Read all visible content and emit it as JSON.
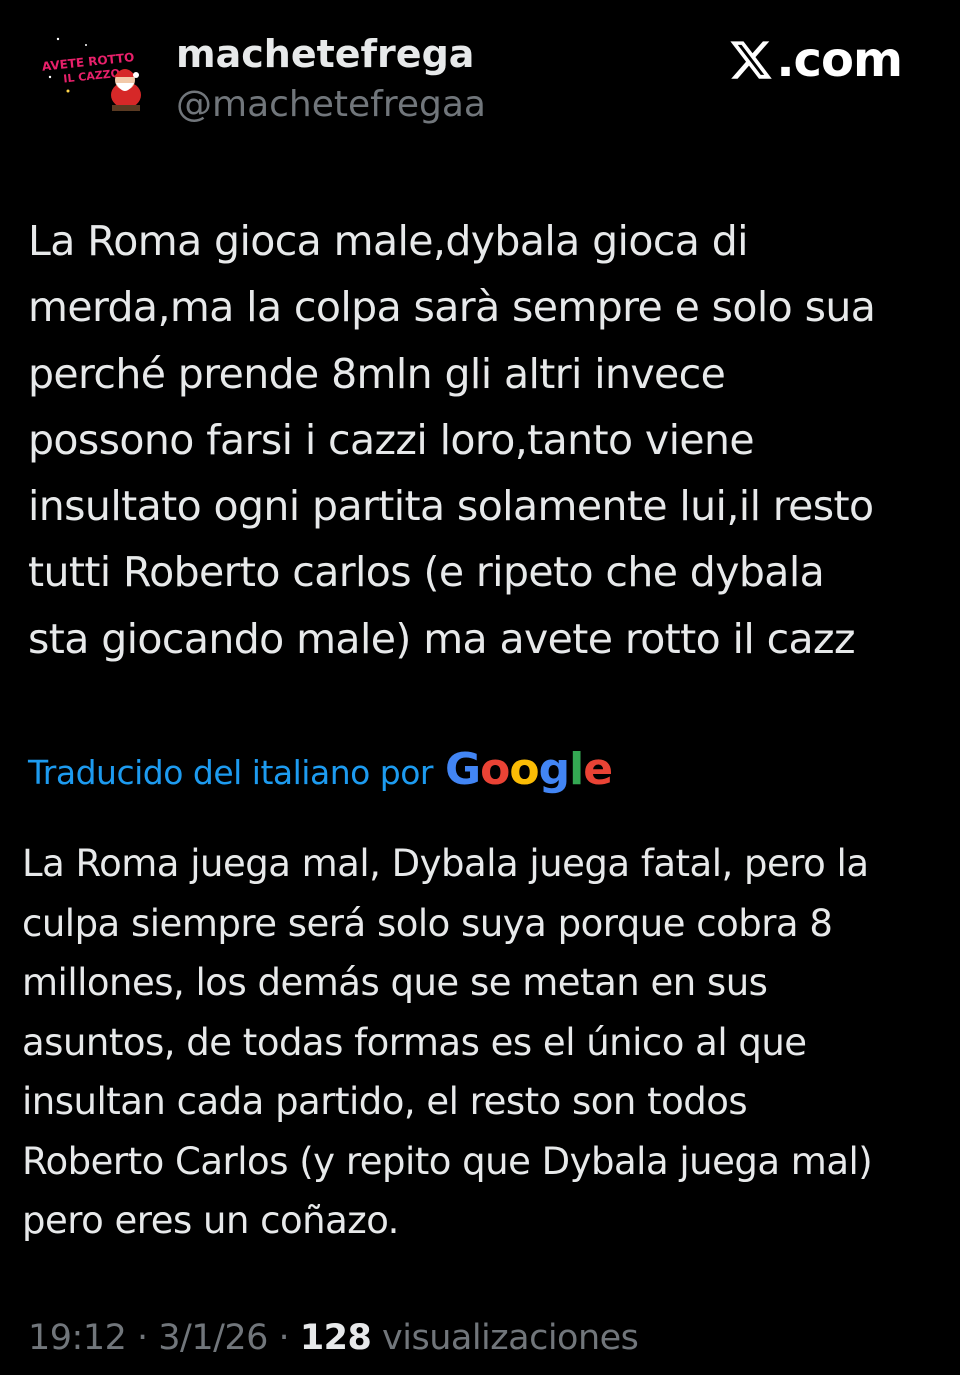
{
  "author": {
    "display_name": "machetefrega",
    "handle": "@machetefregaa",
    "avatar_text_line1": "AVETE ROTTO",
    "avatar_text_line2": "IL CAZZO"
  },
  "brand": {
    "label": ".com",
    "icon": "x-logo-icon"
  },
  "tweet": {
    "text": "La Roma gioca male,dybala gioca di\nmerda,ma la colpa sarà sempre e solo sua\nperché prende 8mln gli altri invece\npossono farsi i cazzi loro,tanto viene\ninsultato ogni partita solamente lui,il resto\ntutti Roberto carlos (e ripeto che dybala\nsta giocando male) ma avete rotto il cazz"
  },
  "translation": {
    "label": "Traducido del italiano por",
    "provider": "Google",
    "text": "La Roma juega mal, Dybala juega fatal, pero la\nculpa siempre será solo suya porque cobra 8\nmillones, los demás que se metan en sus\nasuntos, de todas formas es el único al que\ninsultan cada partido, el resto son todos\nRoberto Carlos (y repito que Dybala juega mal)\npero eres un coñazo."
  },
  "meta": {
    "time": "19:12",
    "separator": " · ",
    "date": "3/1/26",
    "views_count": "128",
    "views_label": "visualizaciones"
  },
  "colors": {
    "background": "#000000",
    "text_primary": "#e7e9ea",
    "text_secondary": "#71767b",
    "link_blue": "#1d9bf0",
    "avatar_text": "#e8206a"
  }
}
